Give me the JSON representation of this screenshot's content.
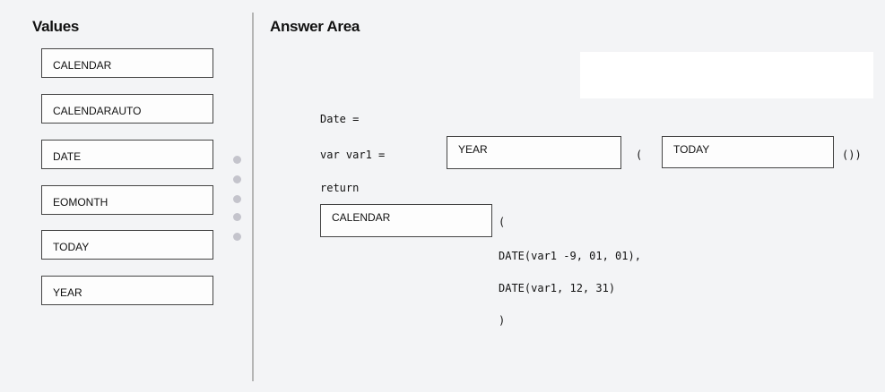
{
  "values_panel": {
    "heading": "Values",
    "items": [
      {
        "label": "CALENDAR"
      },
      {
        "label": "CALENDARAUTO"
      },
      {
        "label": "DATE"
      },
      {
        "label": "EOMONTH"
      },
      {
        "label": "TODAY"
      },
      {
        "label": "YEAR"
      }
    ]
  },
  "answer_area": {
    "heading": "Answer Area",
    "lines": {
      "line1": "Date =",
      "line2_prefix": "var var1 =",
      "paren_open_1": "(",
      "paren_close_1": "())",
      "line3": "return",
      "paren_open_2": "(",
      "line5": "DATE(var1 -9, 01, 01),",
      "line6": "DATE(var1, 12, 31)",
      "line7": ")"
    },
    "slots": {
      "slot1": "YEAR",
      "slot2": "TODAY",
      "slot3": "CALENDAR"
    }
  },
  "icons": {
    "drag_handle": "drag-handle-icon"
  }
}
